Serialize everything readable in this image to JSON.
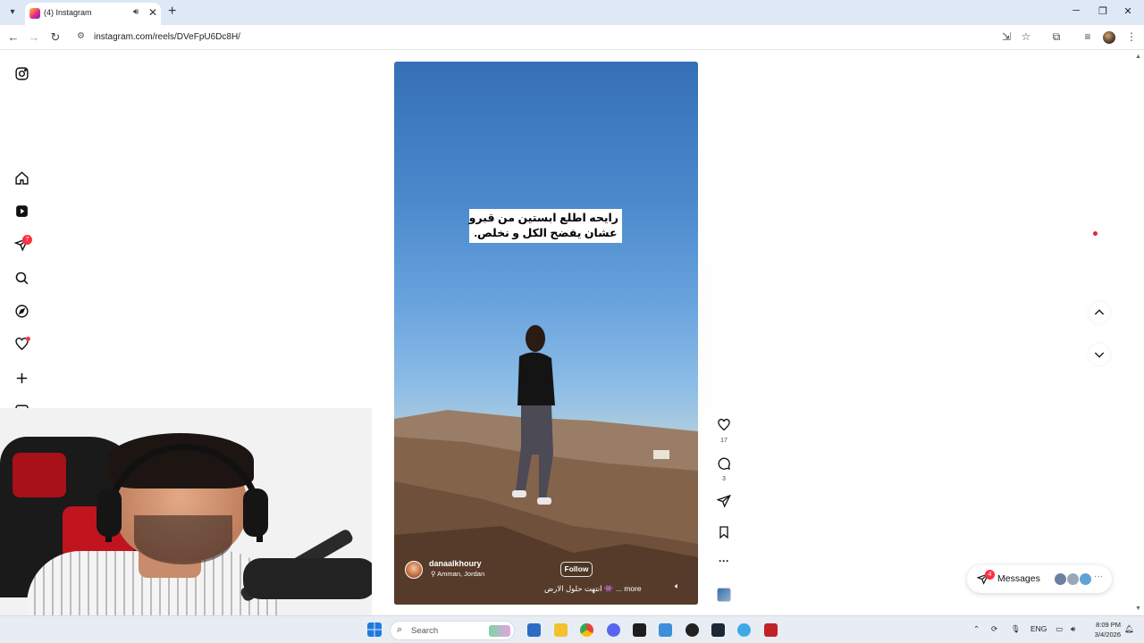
{
  "browser": {
    "tab_title": "(4) Instagram",
    "audio_icon": "speaker-icon",
    "close_glyph": "✕",
    "new_tab_glyph": "+",
    "url": "instagram.com/reels/DVeFpU6Dc8H/",
    "window_controls": [
      "─",
      "❐",
      "✕"
    ]
  },
  "sidebar": {
    "items": [
      {
        "name": "instagram-logo-icon"
      },
      {
        "name": "home-icon"
      },
      {
        "name": "reels-icon"
      },
      {
        "name": "direct-messages-icon",
        "badge": "7"
      },
      {
        "name": "search-icon"
      },
      {
        "name": "explore-compass-icon"
      },
      {
        "name": "notifications-heart-icon",
        "dot": true
      },
      {
        "name": "create-plus-icon"
      },
      {
        "name": "dashboard-icon"
      }
    ]
  },
  "reel": {
    "caption_lines": [
      "رايحه اطلع ابستين من قبرو",
      "عشان يفضح الكل و نخلص."
    ],
    "username": "danaalkhoury",
    "location": "Amman, Jordan",
    "follow_label": "Follow",
    "description": "انتهت حلول الارض 👾 ... more",
    "actions": {
      "likes": "17",
      "comments": "3"
    }
  },
  "messages": {
    "label": "Messages",
    "badge": "4",
    "more": "···"
  },
  "taskbar": {
    "search_placeholder": "Search",
    "language": "ENG",
    "time": "8:09 PM",
    "date": "3/4/2026"
  },
  "colors": {
    "accent_red": "#ff3040",
    "instagram_gradient": [
      "#f9ce34",
      "#ee2a7b",
      "#6228d7"
    ]
  }
}
